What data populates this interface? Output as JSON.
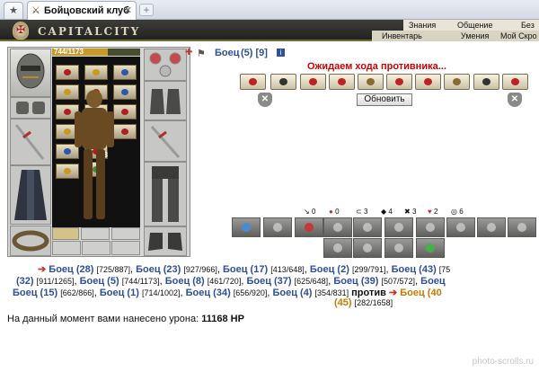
{
  "browser": {
    "tab_title": "Бойцовский клуб",
    "new_tab_symbol": "+",
    "close_symbol": "✕"
  },
  "header": {
    "logo_text": "CAPITALCITY",
    "menu_top": [
      "Знания",
      "Общение",
      "Без"
    ],
    "menu_bottom": [
      "Инвентарь",
      "Умения",
      "Мой Скро"
    ]
  },
  "character": {
    "hp_text": "744/1173",
    "hp_fraction": 0.634,
    "item_badge": "x3"
  },
  "battle": {
    "opponent_name": "Боец",
    "opponent_level": "(5) [9]",
    "waiting_text": "Ожидаем хода противника...",
    "refresh_label": "Обновить",
    "stats": [
      "0",
      "0",
      "3",
      "4",
      "3",
      "2",
      "6"
    ]
  },
  "fighters": {
    "row1": [
      {
        "name": "Боец (28)",
        "hp": "[725/887]"
      },
      {
        "name": "Боец (23)",
        "hp": "[927/966]"
      },
      {
        "name": "Боец (17)",
        "hp": "[413/648]"
      },
      {
        "name": "Боец (2)",
        "hp": "[299/791]"
      },
      {
        "name": "Боец (43)",
        "hp": "[75"
      }
    ],
    "row2_lead": "(32)",
    "row2_lead_hp": "[911/1265]",
    "row2": [
      {
        "name": "Боец (5)",
        "hp": "[744/1173]"
      },
      {
        "name": "Боец (8)",
        "hp": "[461/720]"
      },
      {
        "name": "Боец (37)",
        "hp": "[625/648]"
      },
      {
        "name": "Боец (39)",
        "hp": "[507/572]"
      },
      {
        "name": "Боец",
        "hp": ""
      }
    ],
    "row3": [
      {
        "name": "Боец (15)",
        "hp": "[662/866]"
      },
      {
        "name": "Боец (1)",
        "hp": "[714/1002]"
      },
      {
        "name": "Боец (34)",
        "hp": "[656/920]"
      },
      {
        "name": "Боец (4)",
        "hp": "[354/831]"
      }
    ],
    "versus": "против",
    "enemy_name": "Боец (40",
    "row4_enemy_level": "(45)",
    "row4_enemy_hp": "[282/1658]"
  },
  "damage": {
    "prefix": "На данный момент вами нанесено урона:",
    "value": "11168 HP"
  },
  "watermark": "photo-scrolls.ru"
}
